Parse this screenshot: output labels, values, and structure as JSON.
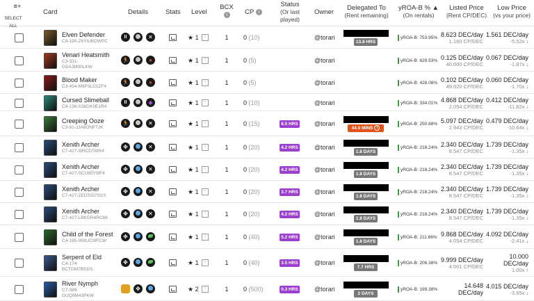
{
  "header": {
    "menu_icon": "≡+",
    "select_all": "SELECT ALL",
    "card": "Card",
    "details": "Details",
    "stats": "Stats",
    "level": "Level",
    "bcx": "BCX",
    "cp": "CP",
    "status": "Status",
    "status_sub1": "(Or last",
    "status_sub2": "played)",
    "owner": "Owner",
    "delegated": "Delegated To",
    "delegated_sub": "(Rent remaining)",
    "yroa": "yROA-B %",
    "yroa_sub": "(On rentals)",
    "listed": "Listed Price",
    "listed_sub": "(Rent CP/DEC)",
    "low": "Low Price",
    "low_sub": "(vs your price)",
    "info_glyph": "i"
  },
  "rows": [
    {
      "name": "Elven Defender",
      "id1": "C4-190-Z6YIUBDWPC",
      "id2": "",
      "thumb_color": "#7a5a2a",
      "details": [
        "pause",
        "gray",
        "x"
      ],
      "star": "★",
      "level": "1",
      "up": "↑",
      "bcx": "1",
      "cp": "0",
      "cp_sub": "(10)",
      "badge": "",
      "owner": "@torari",
      "redacted": true,
      "rent": "13.8 HRS",
      "rent_warn": false,
      "yroa": "yROA-B: 753.95%",
      "price": "8.623 DEC/day",
      "price_sub": "1.160 CP/DEC",
      "low": "1.561 DEC/day",
      "low_sub": "-5.52x",
      "low_dir": "↓"
    },
    {
      "name": "Venari Heatsmith",
      "id1": "C3-331-",
      "id2": "GSAJM90LKW",
      "thumb_color": "#a03a20",
      "details": [
        "run",
        "gray",
        "red"
      ],
      "star": "★",
      "level": "1",
      "up": "↑",
      "bcx": "1",
      "cp": "0",
      "cp_sub": "(5)",
      "badge": "",
      "owner": "@torari",
      "redacted": false,
      "rent": "",
      "rent_warn": false,
      "yroa": "yROA-B: 629.53%",
      "price": "0.125 DEC/day",
      "price_sub": "40.000 CP/DEC",
      "low": "0.067 DEC/day",
      "low_sub": "-1.87x",
      "low_dir": "↓"
    },
    {
      "name": "Blood Maker",
      "id1": "C3-454-M9P3LD1ZF4",
      "id2": "",
      "thumb_color": "#8a1a1a",
      "details": [
        "run",
        "gray",
        "red"
      ],
      "star": "★",
      "level": "1",
      "up": "↑",
      "bcx": "1",
      "cp": "0",
      "cp_sub": "(5)",
      "badge": "",
      "owner": "@torari",
      "redacted": false,
      "rent": "",
      "rent_warn": false,
      "yroa": "yROA-B: 428.08%",
      "price": "0.102 DEC/day",
      "price_sub": "49.020 CP/DEC",
      "low": "0.060 DEC/day",
      "low_sub": "-1.70x",
      "low_dir": "↓"
    },
    {
      "name": "Cursed Slimeball",
      "id1": "C4-136-S38GK0E1R4",
      "id2": "",
      "thumb_color": "#2a8a7a",
      "details": [
        "pause",
        "gray",
        "purple"
      ],
      "star": "★",
      "level": "1",
      "up": "↑",
      "bcx": "1",
      "cp": "0",
      "cp_sub": "(10)",
      "badge": "",
      "owner": "@torari",
      "redacted": false,
      "rent": "",
      "rent_warn": false,
      "yroa": "yROA-B: 334.01%",
      "price": "4.868 DEC/day",
      "price_sub": "2.054 CP/DEC",
      "low": "0.412 DEC/day",
      "low_sub": "-11.82x",
      "low_dir": "↓"
    },
    {
      "name": "Creeping Ooze",
      "id1": "C3-91-JJA8ONFTJK",
      "id2": "",
      "thumb_color": "#3a7a3a",
      "details": [
        "run",
        "gray",
        "x"
      ],
      "star": "★",
      "level": "1",
      "up": "↑",
      "bcx": "1",
      "cp": "0",
      "cp_sub": "(15)",
      "badge": "8.5 HRS",
      "owner": "@torari",
      "redacted": true,
      "rent": "44.9 MINS",
      "rent_warn": true,
      "yroa": "yROA-B: 250.68%",
      "price": "5.097 DEC/day",
      "price_sub": "2.943 CP/DEC",
      "low": "0.479 DEC/day",
      "low_sub": "-10.64x",
      "low_dir": "↓"
    },
    {
      "name": "Xenith Archer",
      "id1": "C7-427-I9RCDT6IR4",
      "id2": "",
      "thumb_color": "#2a4a7a",
      "details": [
        "move",
        "blue",
        "x"
      ],
      "star": "★",
      "level": "1",
      "up": "↑",
      "bcx": "1",
      "cp": "0",
      "cp_sub": "(20)",
      "badge": "4.2 HRS",
      "owner": "@torari",
      "redacted": true,
      "rent": "1.8 DAYS",
      "rent_warn": false,
      "yroa": "yROA-B: 218.24%",
      "price": "2.340 DEC/day",
      "price_sub": "8.547 CP/DEC",
      "low": "1.739 DEC/day",
      "low_sub": "-1.35x",
      "low_dir": "↓"
    },
    {
      "name": "Xenith Archer",
      "id1": "C7-427-SCU85YI8F4",
      "id2": "",
      "thumb_color": "#2a4a7a",
      "details": [
        "move",
        "blue",
        "x"
      ],
      "star": "★",
      "level": "1",
      "up": "↑",
      "bcx": "1",
      "cp": "0",
      "cp_sub": "(20)",
      "badge": "4.2 HRS",
      "owner": "@torari",
      "redacted": true,
      "rent": "1.8 DAYS",
      "rent_warn": false,
      "yroa": "yROA-B: 218.24%",
      "price": "2.340 DEC/day",
      "price_sub": "8.547 CP/DEC",
      "low": "1.739 DEC/day",
      "low_sub": "-1.35x",
      "low_dir": "↓"
    },
    {
      "name": "Xenith Archer",
      "id1": "C7-427-ZEDSSI7SXS",
      "id2": "",
      "thumb_color": "#2a4a7a",
      "details": [
        "move",
        "blue",
        "x"
      ],
      "star": "★",
      "level": "1",
      "up": "↑",
      "bcx": "1",
      "cp": "0",
      "cp_sub": "(20)",
      "badge": "3.7 HRS",
      "owner": "@torari",
      "redacted": true,
      "rent": "1.8 DAYS",
      "rent_warn": false,
      "yroa": "yROA-B: 218.24%",
      "price": "2.340 DEC/day",
      "price_sub": "8.547 CP/DEC",
      "low": "1.739 DEC/day",
      "low_sub": "-1.35x",
      "low_dir": "↓"
    },
    {
      "name": "Xenith Archer",
      "id1": "C7-427-LBKGR4RC68",
      "id2": "",
      "thumb_color": "#2a4a7a",
      "details": [
        "move",
        "blue",
        "x"
      ],
      "star": "★",
      "level": "1",
      "up": "↑",
      "bcx": "1",
      "cp": "0",
      "cp_sub": "(20)",
      "badge": "4.2 HRS",
      "owner": "@torari",
      "redacted": true,
      "rent": "1.8 DAYS",
      "rent_warn": false,
      "yroa": "yROA-B: 218.24%",
      "price": "2.340 DEC/day",
      "price_sub": "8.547 CP/DEC",
      "low": "1.739 DEC/day",
      "low_sub": "-1.35x",
      "low_dir": "↓"
    },
    {
      "name": "Child of the Forest",
      "id1": "C4-185-959UCI9FCW",
      "id2": "",
      "thumb_color": "#2a6a2a",
      "details": [
        "move",
        "blue",
        "green"
      ],
      "star": "★",
      "level": "1",
      "up": "↑",
      "bcx": "1",
      "cp": "0",
      "cp_sub": "(40)",
      "badge": "5.2 HRS",
      "owner": "@torari",
      "redacted": true,
      "rent": "1.8 DAYS",
      "rent_warn": false,
      "yroa": "yROA-B: 211.66%",
      "price": "9.868 DEC/day",
      "price_sub": "4.054 CP/DEC",
      "low": "4.092 DEC/day",
      "low_sub": "-2.41x",
      "low_dir": "↓"
    },
    {
      "name": "Serpent of Eld",
      "id1": "C4-174-",
      "id2": "BCTDM7BSDS",
      "thumb_color": "#3a5a8a",
      "details": [
        "move",
        "blue",
        "green"
      ],
      "star": "★",
      "level": "1",
      "up": "↑",
      "bcx": "1",
      "cp": "0",
      "cp_sub": "(40)",
      "badge": "3.5 HRS",
      "owner": "@torari",
      "redacted": true,
      "rent": "7.7 HRS",
      "rent_warn": false,
      "yroa": "yROA-B: 206.38%",
      "price": "9.999 DEC/day",
      "price_sub": "4.001 CP/DEC",
      "low": "10.000 DEC/day",
      "low_sub": "1.00x",
      "low_dir": "↑"
    },
    {
      "name": "River Nymph",
      "id1": "C7-389-",
      "id2": "GUQ9M43PKW",
      "thumb_color": "#2a5aa0",
      "details": [
        "gold",
        "move",
        "blue"
      ],
      "star": "★",
      "level": "2",
      "up": "↑",
      "bcx": "1",
      "cp": "0",
      "cp_sub": "(500)",
      "badge": "0.3 HRS",
      "owner": "@torari",
      "redacted": true,
      "rent": "2 DAYS",
      "rent_warn": false,
      "yroa": "yROA-B: 199.38%",
      "price": "14.648 DEC/day",
      "price_sub": "",
      "low": "4.015 DEC/day",
      "low_sub": "-3.65x",
      "low_dir": "↓"
    }
  ],
  "colors": {
    "badge": "#9c3fd1",
    "warn": "#e0521a",
    "gray_badge": "#777777"
  }
}
